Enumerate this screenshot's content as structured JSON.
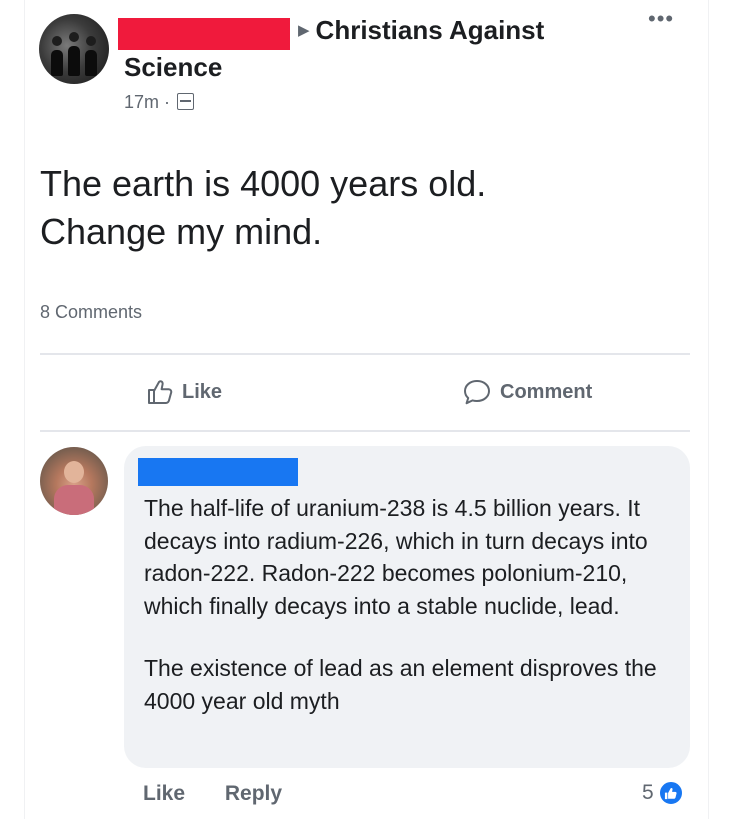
{
  "post": {
    "group_name_line1": "Christians Against",
    "group_name_line2": "Science",
    "timestamp": "17m",
    "separator": "·",
    "privacy_icon": "globe-icon",
    "more_icon": "more-options-icon",
    "text": "The earth is 4000 years old.\nChange my mind.",
    "comments_count": "8 Comments"
  },
  "actions": {
    "like_label": "Like",
    "comment_label": "Comment"
  },
  "comment": {
    "paragraph1": "The half-life of uranium-238 is 4.5 billion years. It decays into radium-226, which in turn decays into radon-222. Radon-222 becomes polonium-210, which finally decays into a stable nuclide, lead.",
    "paragraph2": "The existence of lead as an element disproves the 4000 year old myth",
    "like_label": "Like",
    "reply_label": "Reply",
    "reaction_count": "5"
  },
  "colors": {
    "redaction_red": "#f01a3c",
    "redaction_blue": "#1877f2",
    "text_primary": "#1c1e21",
    "text_secondary": "#606770",
    "bubble_background": "#f0f2f5"
  }
}
